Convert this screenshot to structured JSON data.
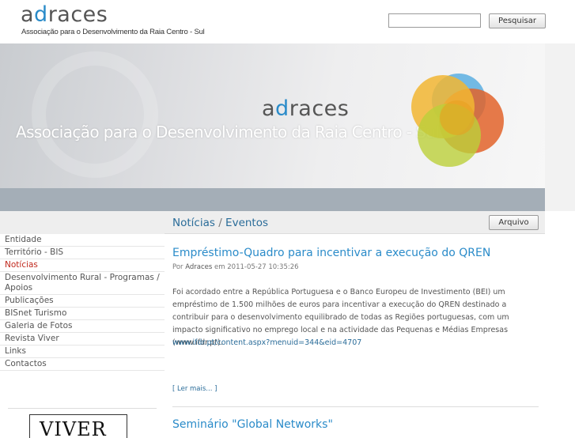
{
  "header": {
    "logo_prefix": "a",
    "logo_d": "d",
    "logo_suffix": "races",
    "logo_subtitle": "Associação para o Desenvolvimento da Raia Centro - Sul",
    "search_placeholder": "",
    "search_button": "Pesquisar"
  },
  "banner": {
    "logo_prefix": "a",
    "logo_d": "d",
    "logo_suffix": "races",
    "subtitle": "Associação para o Desenvolvimento da Raia Centro - Sul",
    "graphic": "colored-overlapping-circles-logo"
  },
  "colors": {
    "accent_blue": "#2a8bc9",
    "active_red": "#c0281d",
    "bar_gray": "#a4aeb7"
  },
  "sidebar": {
    "items": [
      {
        "label": "Entidade"
      },
      {
        "label": "Território - BIS"
      },
      {
        "label": "Notícias",
        "active": true
      },
      {
        "label": "Desenvolvimento Rural - Programas / Apoios"
      },
      {
        "label": "Publicações"
      },
      {
        "label": "BISnet Turismo"
      },
      {
        "label": "Galeria de Fotos"
      },
      {
        "label": "Revista Viver"
      },
      {
        "label": "Links"
      },
      {
        "label": "Contactos"
      }
    ],
    "viver_banner": "VIVER"
  },
  "main": {
    "section_title_a": "Notícias",
    "section_slash": "/",
    "section_title_b": "Eventos",
    "archive_button": "Arquivo",
    "posts": [
      {
        "title": "Empréstimo-Quadro para incentivar a execução do QREN",
        "meta_prefix": "Por",
        "author": "Adraces",
        "meta_mid": "em",
        "date": "2011-05-27 10:35:26",
        "body": "Foi acordado entre a República Portuguesa e o Banco Europeu de Investimento (BEI) um empréstimo de 1.500 milhões de euros para incentivar a execução do QREN destinado a contribuir para o desenvolvimento equilibrado de todas as Regiões portuguesas, com um impacto significativo no emprego local e na actividade das Pequenas e Médias Empresas (www.ifdr.pt).",
        "link": "www.ifdr.pt/content.aspx?menuid=344&eid=4707",
        "read_more": "[ Ler mais... ]"
      },
      {
        "title": "Seminário \"Global Networks\""
      }
    ]
  }
}
